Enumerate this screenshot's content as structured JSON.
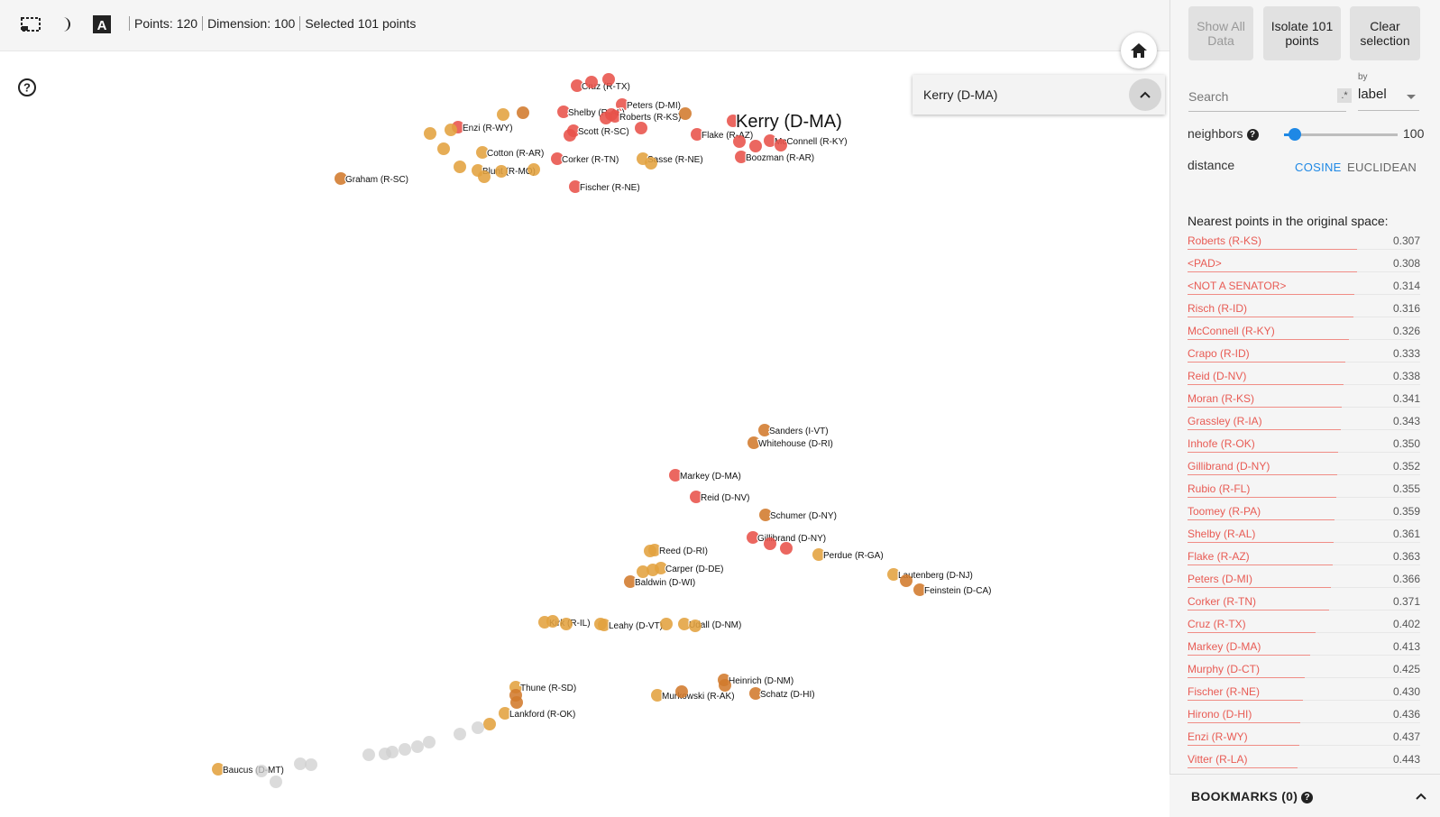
{
  "toolbar": {
    "points": "Points: 120",
    "dimension": "Dimension: 100",
    "selected": "Selected 101 points",
    "select_icon": "selection-rectangle-icon",
    "night_icon": "night-mode-icon",
    "label_icon": "label-toggle-icon"
  },
  "selection_panel": {
    "label": "Kerry (D-MA)"
  },
  "side": {
    "show_all": "Show All Data",
    "isolate": "Isolate 101 points",
    "clear": "Clear selection",
    "search_placeholder": "Search",
    "regex": ".*",
    "by_label": "by",
    "by_value": "label",
    "neighbors_label": "neighbors",
    "neighbors_value": "100",
    "neighbors_fraction": 0.095,
    "distance_label": "distance",
    "cosine": "COSINE",
    "euclidean": "EUCLIDEAN",
    "nn_title": "Nearest points in the original space:",
    "bookmarks": "BOOKMARKS (0)"
  },
  "colors": {
    "red": "#e8524a",
    "orange": "#d27a2c",
    "gold": "#e3a23f",
    "gray": "#cfcfcf",
    "accent": "#1e88e5",
    "link": "#e85b54"
  },
  "neighbors": [
    {
      "name": "Roberts (R-KS)",
      "value": "0.307"
    },
    {
      "name": "<PAD>",
      "value": "0.308"
    },
    {
      "name": "<NOT A SENATOR>",
      "value": "0.314"
    },
    {
      "name": "Risch (R-ID)",
      "value": "0.316"
    },
    {
      "name": "McConnell (R-KY)",
      "value": "0.326"
    },
    {
      "name": "Crapo (R-ID)",
      "value": "0.333"
    },
    {
      "name": "Reid (D-NV)",
      "value": "0.338"
    },
    {
      "name": "Moran (R-KS)",
      "value": "0.341"
    },
    {
      "name": "Grassley (R-IA)",
      "value": "0.343"
    },
    {
      "name": "Inhofe (R-OK)",
      "value": "0.350"
    },
    {
      "name": "Gillibrand (D-NY)",
      "value": "0.352"
    },
    {
      "name": "Rubio (R-FL)",
      "value": "0.355"
    },
    {
      "name": "Toomey (R-PA)",
      "value": "0.359"
    },
    {
      "name": "Shelby (R-AL)",
      "value": "0.361"
    },
    {
      "name": "Flake (R-AZ)",
      "value": "0.363"
    },
    {
      "name": "Peters (D-MI)",
      "value": "0.366"
    },
    {
      "name": "Corker (R-TN)",
      "value": "0.371"
    },
    {
      "name": "Cruz (R-TX)",
      "value": "0.402"
    },
    {
      "name": "Markey (D-MA)",
      "value": "0.413"
    },
    {
      "name": "Murphy (D-CT)",
      "value": "0.425"
    },
    {
      "name": "Fischer (R-NE)",
      "value": "0.430"
    },
    {
      "name": "Hirono (D-HI)",
      "value": "0.436"
    },
    {
      "name": "Enzi (R-WY)",
      "value": "0.437"
    },
    {
      "name": "Vitter (R-LA)",
      "value": "0.443"
    }
  ],
  "plot_labels": [
    "Kerry (D-MA)",
    "Cruz (R-TX)",
    "Peters (D-MI)",
    "Shelby (R-AL)",
    "Roberts (R-KS)",
    "Enzi (R-WY)",
    "Scott (R-SC)",
    "Flake (R-AZ)",
    "McConnell (R-KY)",
    "Cotton (R-AR)",
    "Boozman (R-AR)",
    "Corker (R-TN)",
    "Sasse (R-NE)",
    "Blunt (R-MO)",
    "Graham (R-SC)",
    "Fischer (R-NE)",
    "Sanders (I-VT)",
    "Whitehouse (D-RI)",
    "Markey (D-MA)",
    "Reid (D-NV)",
    "Schumer (D-NY)",
    "Gillibrand (D-NY)",
    "Reed (D-RI)",
    "Perdue (R-GA)",
    "Carper (D-DE)",
    "Lautenberg (D-NJ)",
    "Baldwin (D-WI)",
    "Feinstein (D-CA)",
    "Kirk (R-IL)",
    "Leahy (D-VT)",
    "Udall (D-NM)",
    "Heinrich (D-NM)",
    "Thune (R-SD)",
    "Murkowski (R-AK)",
    "Schatz (D-HI)",
    "Lankford (R-OK)",
    "Baucus (D-MT)"
  ]
}
